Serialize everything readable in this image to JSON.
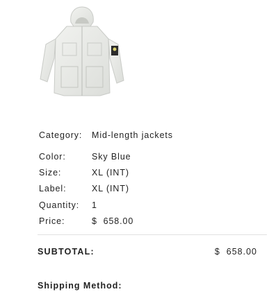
{
  "product": {
    "image_icon": "hooded-jacket-image",
    "details": [
      {
        "label": "Category:",
        "value": "Mid-length jackets"
      },
      {
        "label": "Color:",
        "value": "Sky Blue"
      },
      {
        "label": "Size:",
        "value": "XL (INT)"
      },
      {
        "label": "Label:",
        "value": "XL (INT)"
      },
      {
        "label": "Quantity:",
        "value": "1"
      },
      {
        "label": "Price:",
        "value": "$  658.00"
      }
    ]
  },
  "summary": {
    "subtotal_label": "SUBTOTAL:",
    "subtotal_value": "$  658.00",
    "shipping_label": "Shipping Method:"
  }
}
